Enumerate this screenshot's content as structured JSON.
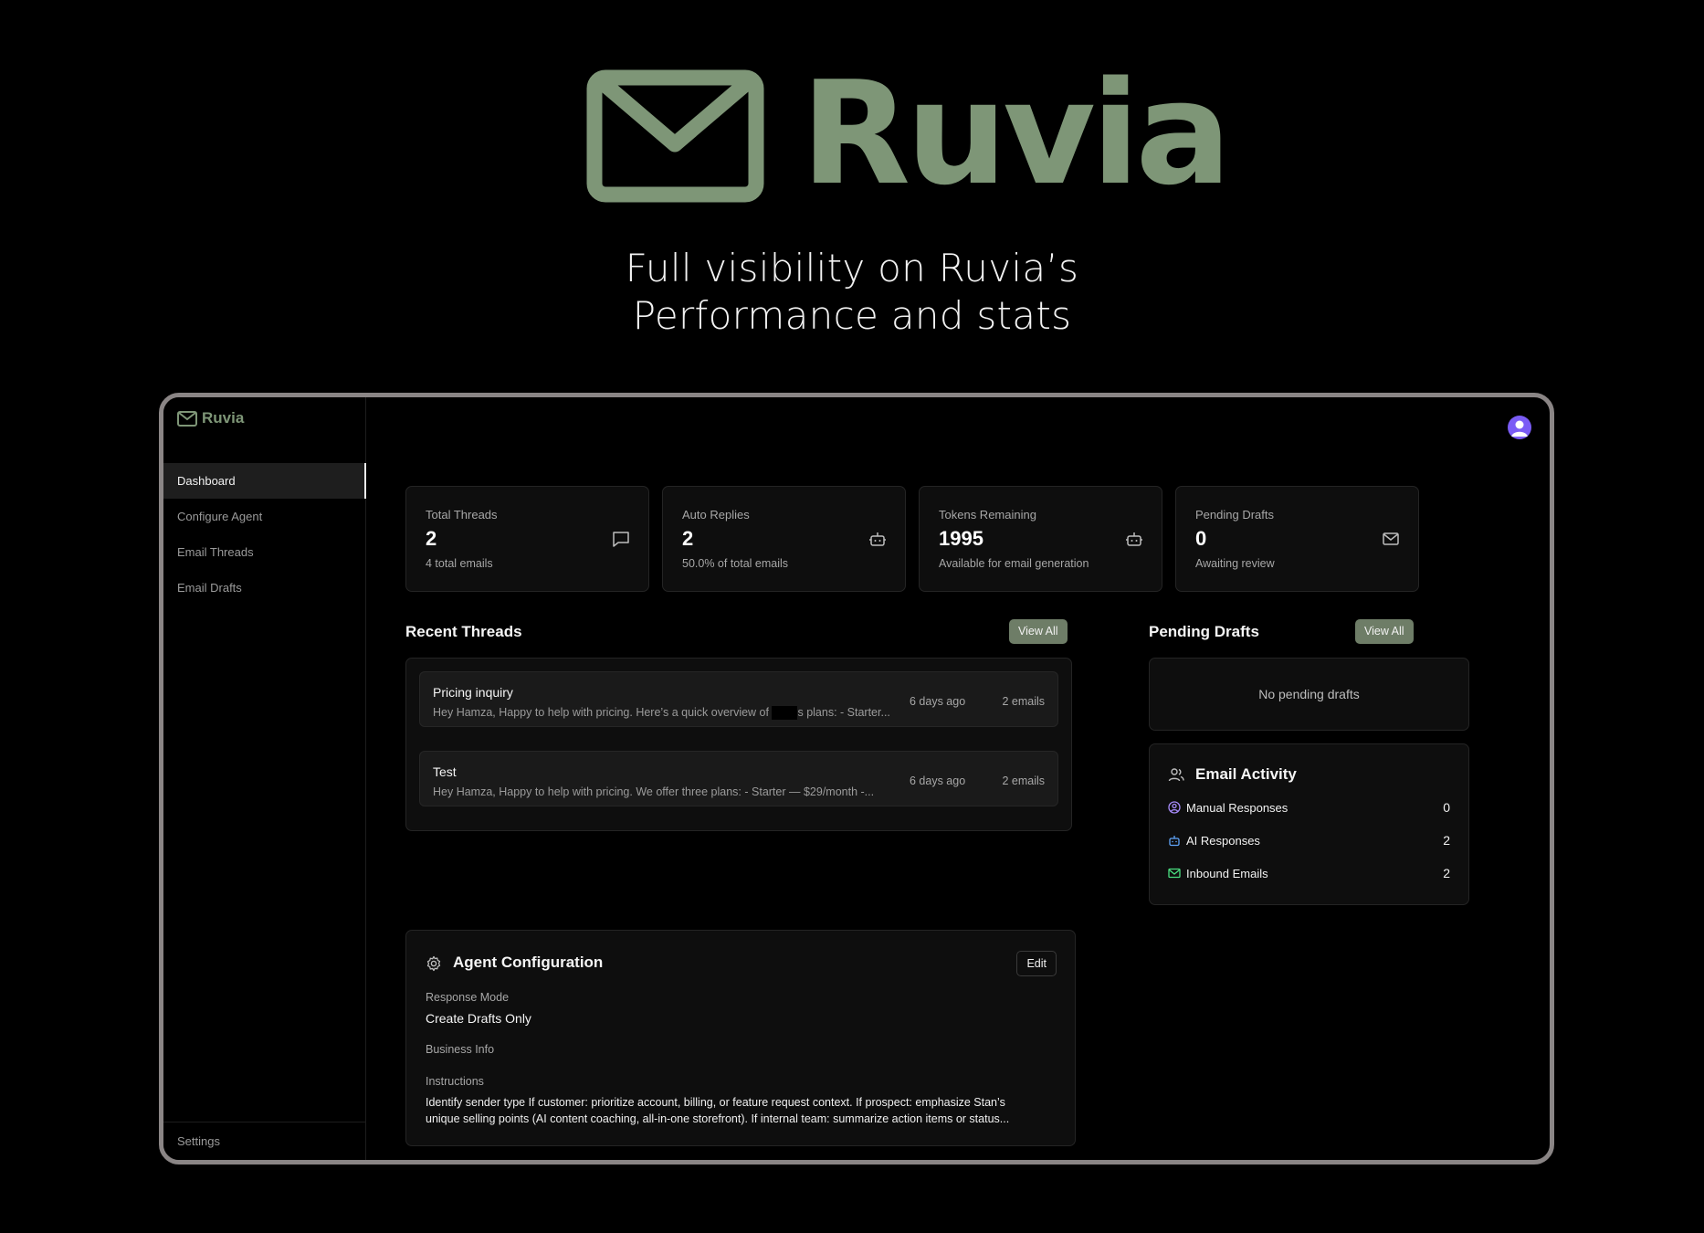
{
  "hero": {
    "brand": "Ruvia",
    "tagline_line1": "Full visibility on Ruvia’s",
    "tagline_line2": "Performance and stats"
  },
  "sidebar": {
    "brand": "Ruvia",
    "items": [
      {
        "label": "Dashboard",
        "active": true
      },
      {
        "label": "Configure Agent"
      },
      {
        "label": "Email Threads"
      },
      {
        "label": "Email Drafts"
      }
    ],
    "settings_label": "Settings"
  },
  "stats": [
    {
      "label": "Total Threads",
      "value": "2",
      "sub": "4 total emails",
      "icon": "message-square-icon"
    },
    {
      "label": "Auto Replies",
      "value": "2",
      "sub": "50.0% of total emails",
      "icon": "bot-icon"
    },
    {
      "label": "Tokens Remaining",
      "value": "1995",
      "sub": "Available for email generation",
      "icon": "bot-icon"
    },
    {
      "label": "Pending Drafts",
      "value": "0",
      "sub": "Awaiting review",
      "icon": "mail-icon"
    }
  ],
  "recent_threads": {
    "title": "Recent Threads",
    "view_all": "View All",
    "items": [
      {
        "title": "Pricing inquiry",
        "preview_a": "Hey Hamza, Happy to help with pricing. Here’s a quick overview of ",
        "preview_b": "s plans: - Starter...",
        "time": "6 days ago",
        "count": "2 emails"
      },
      {
        "title": "Test",
        "preview": "Hey Hamza, Happy to help with pricing. We offer three plans: - Starter — $29/month -...",
        "time": "6 days ago",
        "count": "2 emails"
      }
    ]
  },
  "pending_drafts": {
    "title": "Pending Drafts",
    "view_all": "View All",
    "empty": "No pending drafts"
  },
  "email_activity": {
    "title": "Email Activity",
    "rows": [
      {
        "label": "Manual Responses",
        "value": "0",
        "icon": "user-circle-icon",
        "color": "#a78bfa"
      },
      {
        "label": "AI Responses",
        "value": "2",
        "icon": "bot-icon",
        "color": "#60a5fa"
      },
      {
        "label": "Inbound Emails",
        "value": "2",
        "icon": "mail-icon",
        "color": "#4ade80"
      }
    ]
  },
  "agent_config": {
    "title": "Agent Configuration",
    "edit": "Edit",
    "response_mode_label": "Response Mode",
    "response_mode_value": "Create Drafts Only",
    "business_info_label": "Business Info",
    "instructions_label": "Instructions",
    "instructions_line1": "Identify sender type If customer: prioritize account, billing, or feature request context. If prospect: emphasize Stan’s",
    "instructions_line2": "unique selling points (AI content coaching, all-in-one storefront). If internal team: summarize action items or status..."
  },
  "colors": {
    "brand": "#7e9677",
    "accent_button": "#6e7d67",
    "avatar": "#7a5cf5"
  }
}
